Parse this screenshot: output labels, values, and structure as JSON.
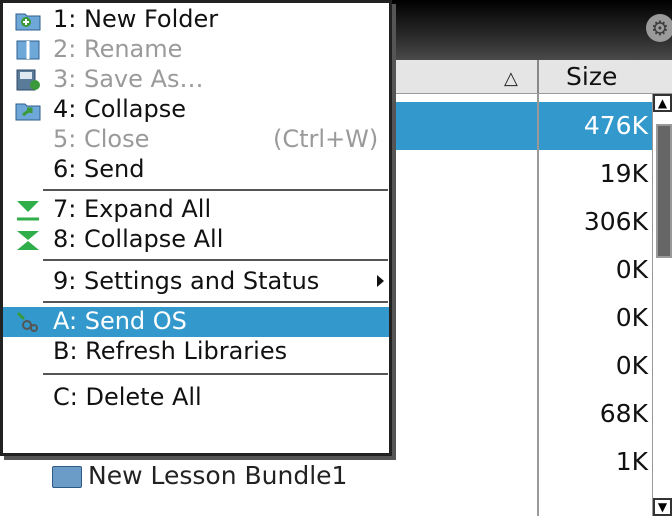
{
  "header": {
    "size_label": "Size"
  },
  "rows": [
    {
      "size": "476K",
      "selected": true
    },
    {
      "size": "19K"
    },
    {
      "size": "306K"
    },
    {
      "size": "0K"
    },
    {
      "size": "0K"
    },
    {
      "size": "0K"
    },
    {
      "size": "68K"
    },
    {
      "size": "1K"
    }
  ],
  "list": {
    "item_new_lesson": "New Lesson Bundle1"
  },
  "menu": {
    "items": [
      {
        "label": "1: New Folder",
        "icon": "new-folder-icon"
      },
      {
        "label": "2: Rename",
        "icon": "rename-icon",
        "disabled": true
      },
      {
        "label": "3: Save As…",
        "icon": "save-as-icon",
        "disabled": true
      },
      {
        "label": "4: Collapse",
        "icon": "collapse-folder-icon"
      },
      {
        "label": "5: Close",
        "shortcut": "(Ctrl+W)",
        "disabled": true
      },
      {
        "label": "6: Send"
      },
      {
        "label": "7: Expand All",
        "icon": "expand-all-icon"
      },
      {
        "label": "8: Collapse All",
        "icon": "collapse-all-icon"
      },
      {
        "label": "9: Settings and Status",
        "submenu": true
      },
      {
        "label": "A: Send OS",
        "icon": "send-os-icon",
        "highlighted": true
      },
      {
        "label": "B: Refresh Libraries"
      },
      {
        "label": "C: Delete All"
      }
    ]
  },
  "colors": {
    "selection": "#3399cc",
    "topbar": "#000000",
    "header": "#e5e5e5"
  }
}
